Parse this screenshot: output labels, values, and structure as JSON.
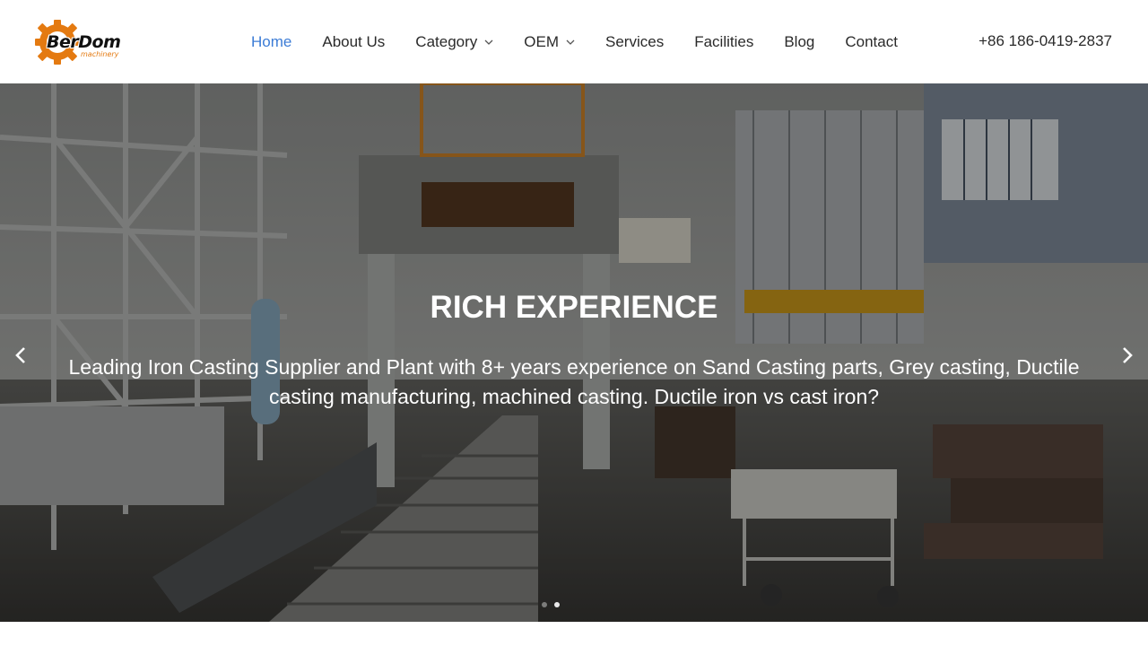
{
  "brand": {
    "name": "BerDom",
    "tagline": "machinery",
    "accent_color": "#e47a11"
  },
  "nav": {
    "items": [
      {
        "label": "Home",
        "active": true
      },
      {
        "label": "About Us"
      },
      {
        "label": "Category",
        "dropdown": true
      },
      {
        "label": "OEM",
        "dropdown": true
      },
      {
        "label": "Services"
      },
      {
        "label": "Facilities"
      },
      {
        "label": "Blog"
      },
      {
        "label": "Contact"
      }
    ],
    "active_color": "#3c7cd6"
  },
  "header": {
    "phone": "+86 186-0419-2837"
  },
  "hero": {
    "title": "RICH EXPERIENCE",
    "description": "Leading Iron Casting Supplier and Plant with 8+ years experience on Sand Casting parts, Grey casting, Ductile casting manufacturing, machined casting. Ductile iron vs cast iron?",
    "prev_icon": "chevron-left-icon",
    "next_icon": "chevron-right-icon",
    "slide_indicator": {
      "total": 2,
      "active": 2
    }
  }
}
